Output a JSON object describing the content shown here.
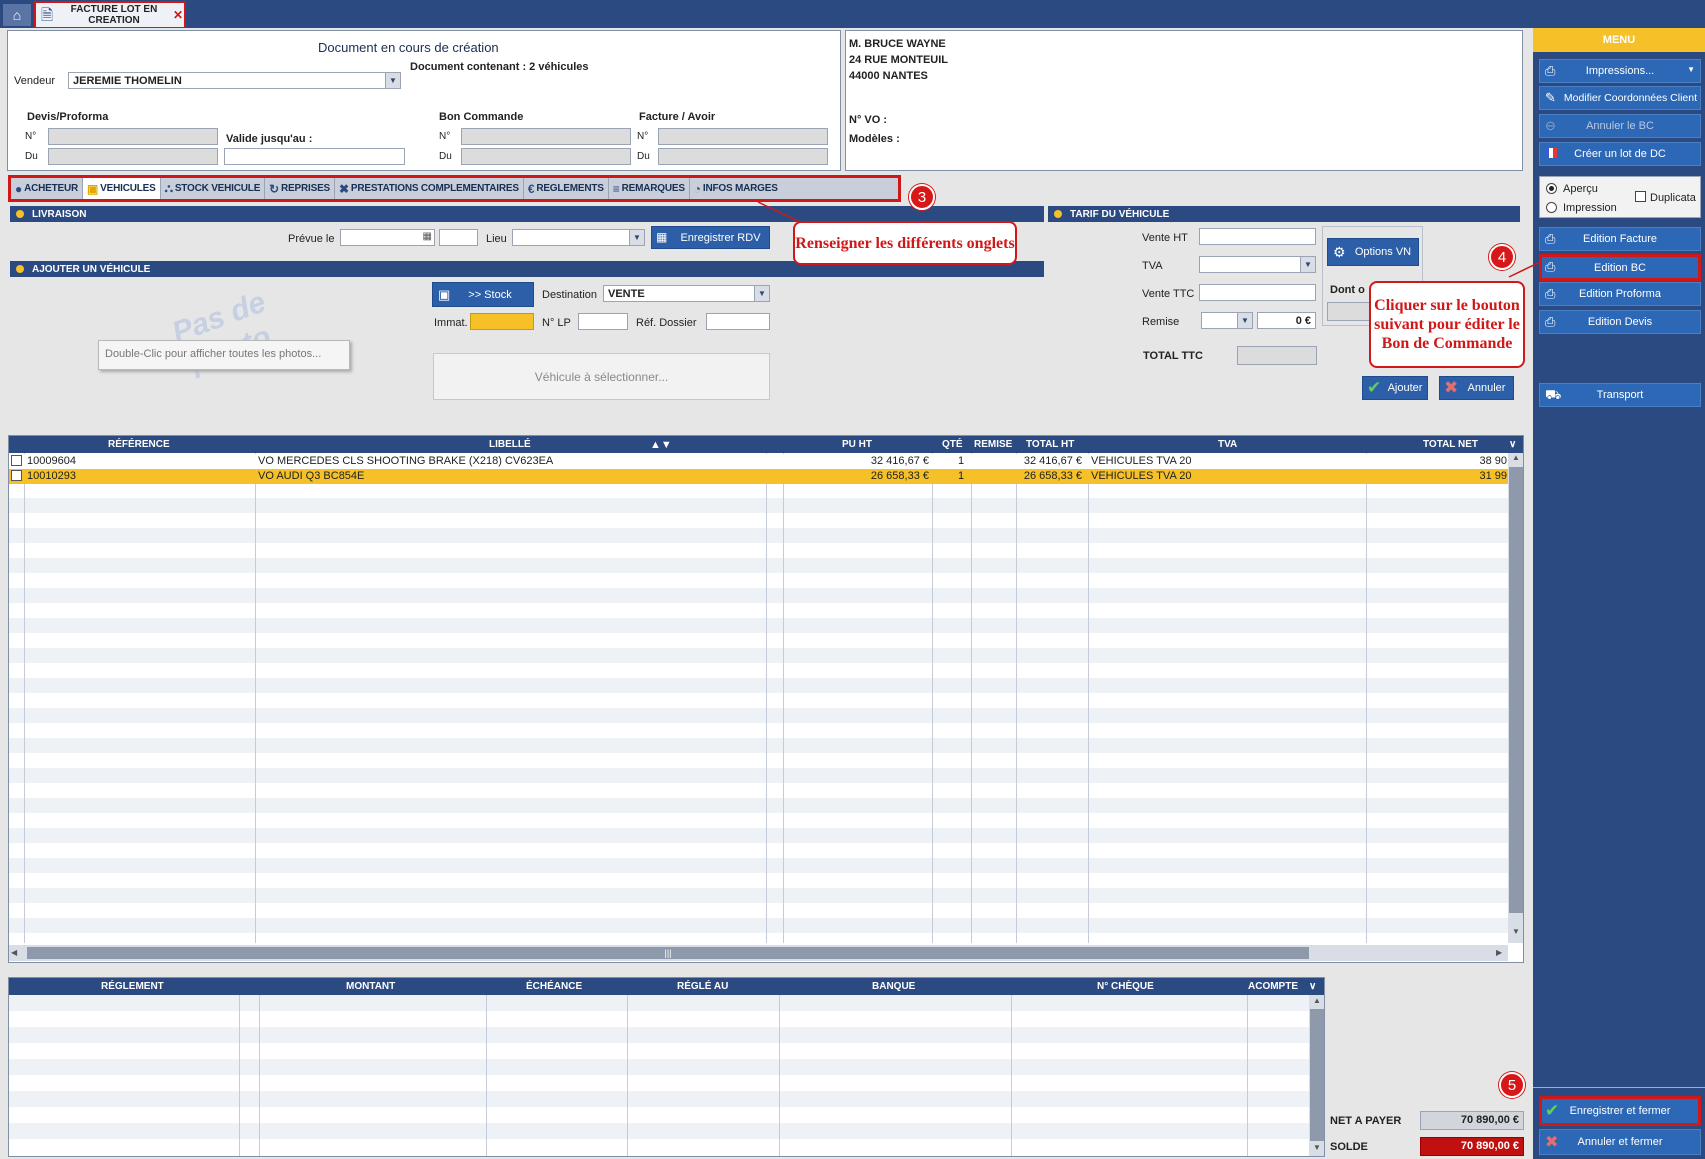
{
  "tab": {
    "title_line1": "FACTURE LOT EN",
    "title_line2": "CREATION"
  },
  "header": {
    "title": "Document en cours de création",
    "subtitle": "Document contenant : 2 véhicules",
    "vendeur_label": "Vendeur",
    "vendeur_value": "JEREMIE THOMELIN",
    "devis_title": "Devis/Proforma",
    "bc_title": "Bon Commande",
    "facture_title": "Facture / Avoir",
    "no_label": "N°",
    "du_label": "Du",
    "valide_label": "Valide jusqu'au :"
  },
  "client": {
    "name": "M. BRUCE WAYNE",
    "street": "24 RUE MONTEUIL",
    "city": "44000 NANTES",
    "vo_label": "N° VO :",
    "modeles_label": "Modèles :"
  },
  "tabs": [
    {
      "label": "ACHETEUR",
      "icon": "user-icon"
    },
    {
      "label": "VEHICULES",
      "icon": "car-icon"
    },
    {
      "label": "STOCK VEHICULE",
      "icon": "cart-icon"
    },
    {
      "label": "REPRISES",
      "icon": "refresh-icon"
    },
    {
      "label": "PRESTATIONS COMPLEMENTAIRES",
      "icon": "tools-icon"
    },
    {
      "label": "REGLEMENTS",
      "icon": "euro-icon"
    },
    {
      "label": "REMARQUES",
      "icon": "lines-icon"
    },
    {
      "label": "INFOS MARGES",
      "icon": "gauge-icon"
    }
  ],
  "livraison": {
    "title": "LIVRAISON",
    "prevue_label": "Prévue le",
    "lieu_label": "Lieu",
    "rdv_button": "Enregistrer RDV"
  },
  "ajout": {
    "title": "AJOUTER UN VÉHICULE",
    "watermark": "Pas de photo",
    "tooltip": "Double-Clic pour afficher toutes les photos...",
    "stock_button": ">> Stock",
    "destination_label": "Destination",
    "destination_value": "VENTE",
    "immat_label": "Immat.",
    "nlp_label": "N° LP",
    "ref_label": "Réf. Dossier",
    "vehicule_placeholder": "Véhicule à sélectionner..."
  },
  "tarif": {
    "title": "TARIF DU VÉHICULE",
    "vente_ht_label": "Vente HT",
    "tva_label": "TVA",
    "vente_ttc_label": "Vente TTC",
    "remise_label": "Remise",
    "remise_value": "0 €",
    "total_ttc_label": "TOTAL TTC",
    "options_button": "Options VN",
    "dont_label": "Dont o",
    "ajouter_button": "Ajouter",
    "annuler_button": "Annuler"
  },
  "grid": {
    "headers": [
      "RÉFÉRENCE",
      "LIBELLÉ",
      "PU HT",
      "QTÉ",
      "REMISE",
      "TOTAL HT",
      "TVA",
      "TOTAL NET"
    ],
    "rows": [
      {
        "ref": "10009604",
        "libelle": "VO MERCEDES CLS SHOOTING BRAKE (X218) CV623EA",
        "pu": "32 416,67 €",
        "qte": "1",
        "total_ht": "32 416,67 €",
        "tva": "VEHICULES TVA 20",
        "net": "38 90"
      },
      {
        "ref": "10010293",
        "libelle": "VO AUDI Q3 BC854E",
        "pu": "26 658,33 €",
        "qte": "1",
        "total_ht": "26 658,33 €",
        "tva": "VEHICULES TVA 20",
        "net": "31 99"
      }
    ]
  },
  "reglements": {
    "headers": [
      "RÉGLEMENT",
      "MONTANT",
      "ÉCHÉANCE",
      "RÉGLÉ AU",
      "BANQUE",
      "N° CHÈQUE",
      "ACOMPTE"
    ]
  },
  "totals": {
    "net_label": "NET A PAYER",
    "net_value": "70 890,00 €",
    "solde_label": "SOLDE",
    "solde_value": "70 890,00 €"
  },
  "menu": {
    "title": "MENU",
    "impressions": "Impressions...",
    "modifier": "Modifier Coordonnées Client",
    "annuler_bc": "Annuler le BC",
    "creer_lot": "Créer un lot de DC",
    "apercu": "Aperçu",
    "impression": "Impression",
    "duplicata": "Duplicata",
    "edition_facture": "Edition Facture",
    "edition_bc": "Edition BC",
    "edition_proforma": "Edition Proforma",
    "edition_devis": "Edition Devis",
    "transport": "Transport",
    "enregistrer": "Enregistrer et fermer",
    "annuler_fermer": "Annuler et fermer"
  },
  "annotations": {
    "badge3": "3",
    "badge4": "4",
    "badge5": "5",
    "callout3": "Renseigner les différents onglets",
    "callout4": "Cliquer sur le bouton suivant pour éditer le Bon de Commande"
  },
  "colors": {
    "navy": "#2c4a82",
    "accent": "#f5c028",
    "red": "#d01818",
    "button": "#2c68b6"
  }
}
